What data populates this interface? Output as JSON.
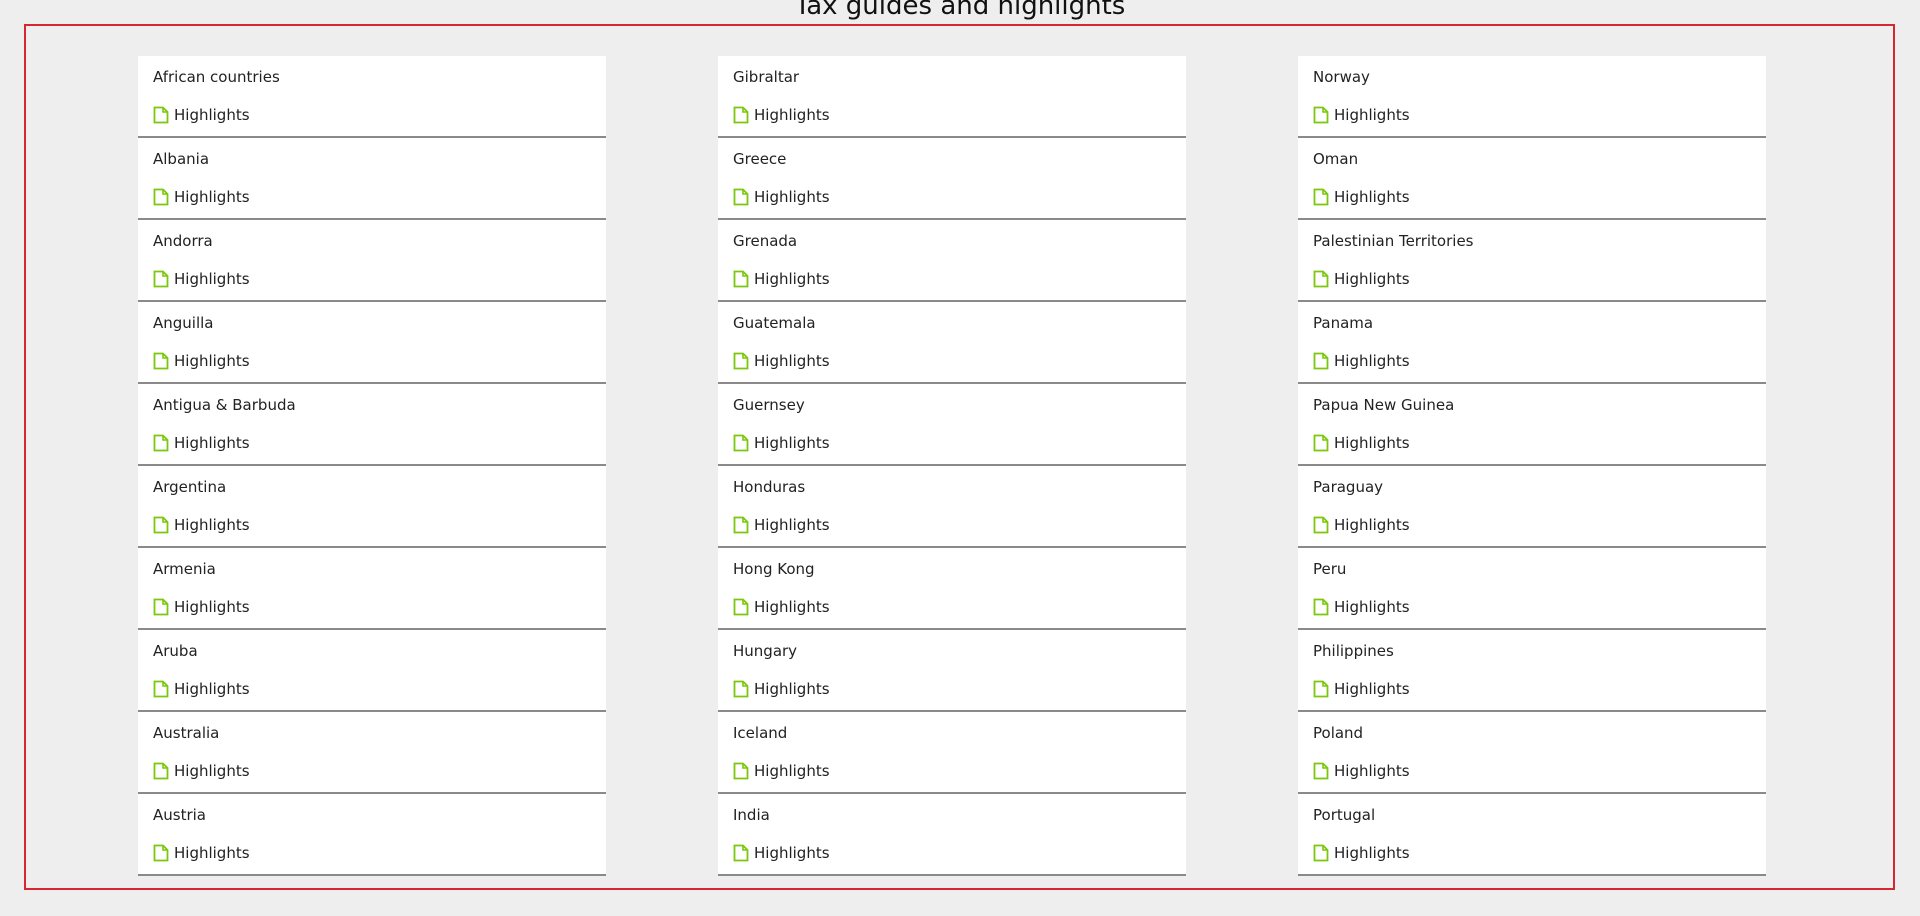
{
  "page": {
    "title": "Tax guides and highlights",
    "accent_color": "#d7262d",
    "icon_color": "#7ac70c"
  },
  "columns": [
    {
      "items": [
        {
          "name": "African countries",
          "link_label": "Highlights",
          "link_icon": "document-icon"
        },
        {
          "name": "Albania",
          "link_label": "Highlights",
          "link_icon": "document-icon"
        },
        {
          "name": "Andorra",
          "link_label": "Highlights",
          "link_icon": "document-icon"
        },
        {
          "name": "Anguilla",
          "link_label": "Highlights",
          "link_icon": "document-icon"
        },
        {
          "name": "Antigua & Barbuda",
          "link_label": "Highlights",
          "link_icon": "document-icon"
        },
        {
          "name": "Argentina",
          "link_label": "Highlights",
          "link_icon": "document-icon"
        },
        {
          "name": "Armenia",
          "link_label": "Highlights",
          "link_icon": "document-icon"
        },
        {
          "name": "Aruba",
          "link_label": "Highlights",
          "link_icon": "document-icon"
        },
        {
          "name": "Australia",
          "link_label": "Highlights",
          "link_icon": "document-icon"
        },
        {
          "name": "Austria",
          "link_label": "Highlights",
          "link_icon": "document-icon"
        }
      ]
    },
    {
      "items": [
        {
          "name": "Gibraltar",
          "link_label": "Highlights",
          "link_icon": "document-icon"
        },
        {
          "name": "Greece",
          "link_label": "Highlights",
          "link_icon": "document-icon"
        },
        {
          "name": "Grenada",
          "link_label": "Highlights",
          "link_icon": "document-icon"
        },
        {
          "name": "Guatemala",
          "link_label": "Highlights",
          "link_icon": "document-icon"
        },
        {
          "name": "Guernsey",
          "link_label": "Highlights",
          "link_icon": "document-icon"
        },
        {
          "name": "Honduras",
          "link_label": "Highlights",
          "link_icon": "document-icon"
        },
        {
          "name": "Hong Kong",
          "link_label": "Highlights",
          "link_icon": "document-icon"
        },
        {
          "name": "Hungary",
          "link_label": "Highlights",
          "link_icon": "document-icon"
        },
        {
          "name": "Iceland",
          "link_label": "Highlights",
          "link_icon": "document-icon"
        },
        {
          "name": "India",
          "link_label": "Highlights",
          "link_icon": "document-icon"
        }
      ]
    },
    {
      "items": [
        {
          "name": "Norway",
          "link_label": "Highlights",
          "link_icon": "document-icon"
        },
        {
          "name": "Oman",
          "link_label": "Highlights",
          "link_icon": "document-icon"
        },
        {
          "name": "Palestinian Territories",
          "link_label": "Highlights",
          "link_icon": "document-icon"
        },
        {
          "name": "Panama",
          "link_label": "Highlights",
          "link_icon": "document-icon"
        },
        {
          "name": "Papua New Guinea",
          "link_label": "Highlights",
          "link_icon": "document-icon"
        },
        {
          "name": "Paraguay",
          "link_label": "Highlights",
          "link_icon": "document-icon"
        },
        {
          "name": "Peru",
          "link_label": "Highlights",
          "link_icon": "document-icon"
        },
        {
          "name": "Philippines",
          "link_label": "Highlights",
          "link_icon": "document-icon"
        },
        {
          "name": "Poland",
          "link_label": "Highlights",
          "link_icon": "document-icon"
        },
        {
          "name": "Portugal",
          "link_label": "Highlights",
          "link_icon": "document-icon"
        }
      ]
    }
  ]
}
